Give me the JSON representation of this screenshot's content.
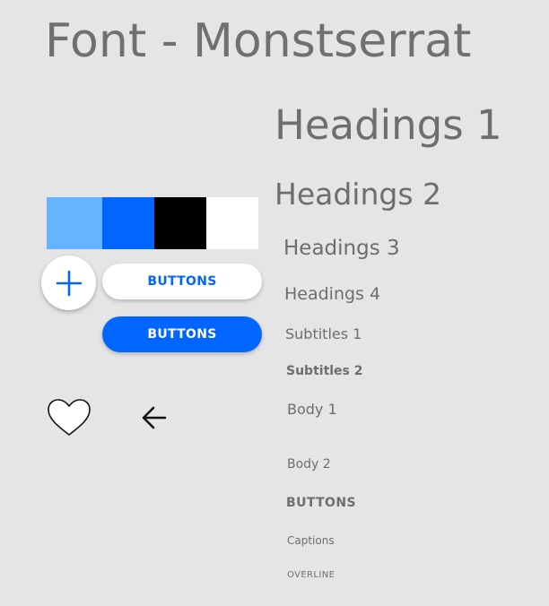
{
  "title": "Font - Monstserrat",
  "palette": {
    "swatches": [
      {
        "name": "light-blue",
        "color": "#66b3ff"
      },
      {
        "name": "blue",
        "color": "#0066ff"
      },
      {
        "name": "black",
        "color": "#000000"
      },
      {
        "name": "white",
        "color": "#ffffff"
      }
    ]
  },
  "components": {
    "fab_icon": "plus-icon",
    "button_outline_label": "BUTTONS",
    "button_filled_label": "BUTTONS",
    "icons": [
      "heart-icon",
      "arrow-left-icon"
    ],
    "accent_color": "#0066ff"
  },
  "typography": {
    "headings_1": "Headings 1",
    "headings_2": "Headings 2",
    "headings_3": "Headings 3",
    "headings_4": "Headings 4",
    "subtitles_1": "Subtitles 1",
    "subtitles_2": "Subtitles 2",
    "body_1": "Body 1",
    "body_2": "Body 2",
    "buttons": "BUTTONS",
    "captions": "Captions",
    "overline": "OVERLINE"
  }
}
